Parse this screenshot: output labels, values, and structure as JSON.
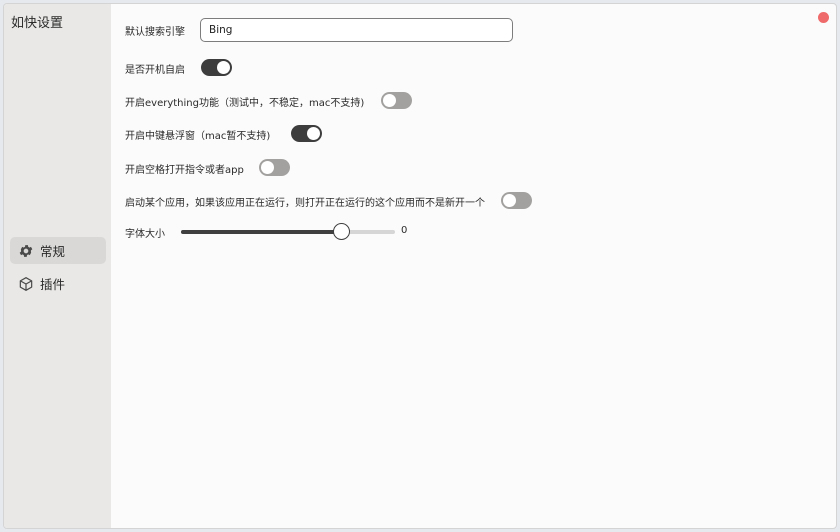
{
  "app": {
    "title": "如快设置"
  },
  "sidebar": {
    "items": [
      {
        "label": "常规",
        "icon": "gear-icon",
        "active": true
      },
      {
        "label": "插件",
        "icon": "cube-icon",
        "active": false
      }
    ]
  },
  "settings": {
    "search_engine": {
      "label": "默认搜索引擎",
      "value": "Bing"
    },
    "autostart": {
      "label": "是否开机自启",
      "on": true
    },
    "everything": {
      "label": "开启everything功能（测试中，不稳定，mac不支持)",
      "on": false
    },
    "middle_button": {
      "label": "开启中键悬浮窗（mac暂不支持)",
      "on": true
    },
    "space_open": {
      "label": "开启空格打开指令或者app",
      "on": false
    },
    "reuse_app": {
      "label": "启动某个应用，如果该应用正在运行，则打开正在运行的这个应用而不是新开一个",
      "on": false
    },
    "font_size": {
      "label": "字体大小",
      "value_text": "0",
      "fill_fraction": 0.75
    }
  },
  "colors": {
    "toggle_on": "#3d3d3d",
    "toggle_off": "#a3a19f",
    "close_dot": "#ef6a6a",
    "sidebar_bg": "#e9e8e6"
  }
}
